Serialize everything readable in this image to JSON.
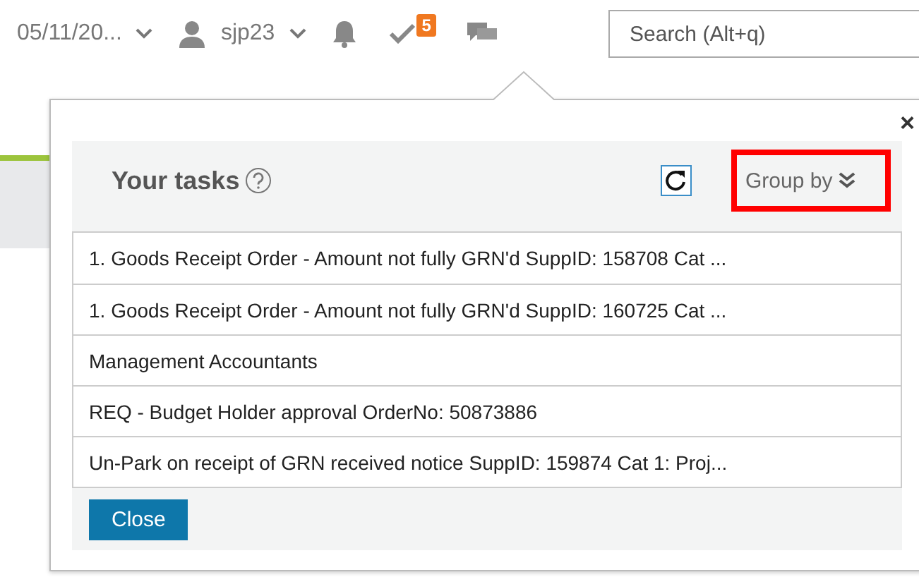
{
  "top_bar": {
    "date": "05/11/20...",
    "user": "sjp23",
    "tasks_badge": "5",
    "search": {
      "placeholder": "Search (Alt+q)"
    }
  },
  "tasks_popup": {
    "title": "Your tasks",
    "group_by": {
      "label": "Group by",
      "highlighted": true
    },
    "tasks": [
      {
        "text": "1. Goods Receipt Order - Amount not fully GRN'd SuppID: 158708 Cat ..."
      },
      {
        "text": "1. Goods Receipt Order - Amount not fully GRN'd SuppID: 160725 Cat ..."
      },
      {
        "text": "Management Accountants"
      },
      {
        "text": "REQ - Budget Holder approval OrderNo: 50873886"
      },
      {
        "text": "Un-Park on receipt of GRN received notice SuppID: 159874 Cat 1: Proj..."
      }
    ],
    "close_button": "Close",
    "close_icon": "×"
  }
}
